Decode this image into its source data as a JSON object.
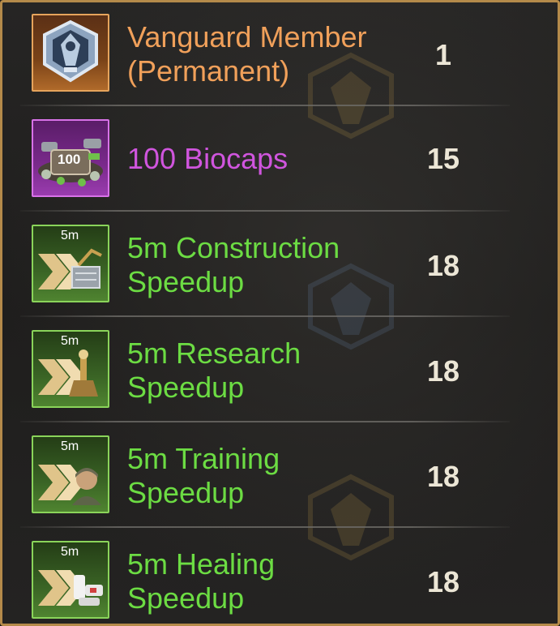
{
  "colors": {
    "orange": "#f0a05a",
    "purple": "#d055de",
    "green": "#6cdc43",
    "quantity": "#ece6d6",
    "frame_border": "#b48a4a"
  },
  "rewards": [
    {
      "name": "Vanguard Member (Permanent)",
      "line1": "Vanguard Member",
      "line2": "(Permanent)",
      "quantity": "1",
      "icon": "vanguard-emblem-icon",
      "rarity": "orange"
    },
    {
      "name": "100 Biocaps",
      "line1": "100 Biocaps",
      "line2": "",
      "quantity": "15",
      "icon": "biocaps-pile-icon",
      "icon_text": "100",
      "rarity": "purple"
    },
    {
      "name": "5m Construction Speedup",
      "line1": "5m Construction",
      "line2": "Speedup",
      "quantity": "18",
      "icon": "construction-speedup-icon",
      "icon_tag": "5m",
      "rarity": "green"
    },
    {
      "name": "5m Research Speedup",
      "line1": "5m Research",
      "line2": "Speedup",
      "quantity": "18",
      "icon": "research-speedup-icon",
      "icon_tag": "5m",
      "rarity": "green"
    },
    {
      "name": "5m Training Speedup",
      "line1": "5m Training",
      "line2": "Speedup",
      "quantity": "18",
      "icon": "training-speedup-icon",
      "icon_tag": "5m",
      "rarity": "green"
    },
    {
      "name": "5m Healing Speedup",
      "line1": "5m Healing",
      "line2": "Speedup",
      "quantity": "18",
      "icon": "healing-speedup-icon",
      "icon_tag": "5m",
      "rarity": "green"
    }
  ]
}
